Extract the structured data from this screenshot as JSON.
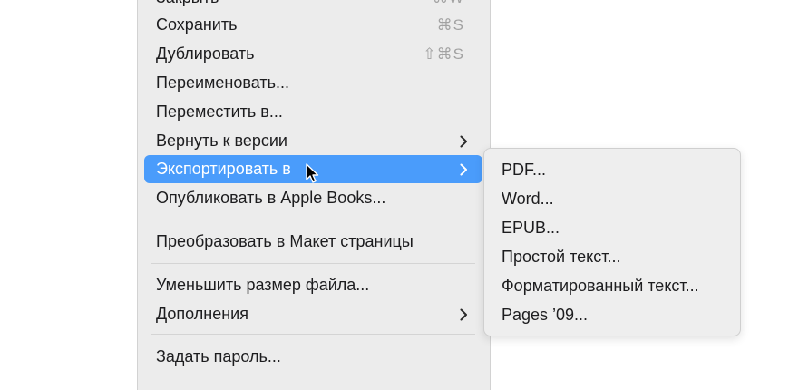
{
  "file_menu": {
    "items": [
      {
        "label": "Закрыть",
        "shortcut": "⌘W"
      },
      {
        "label": "Сохранить",
        "shortcut": "⌘S"
      },
      {
        "label": "Дублировать",
        "shortcut": "⇧⌘S"
      },
      {
        "label": "Переименовать..."
      },
      {
        "label": "Переместить в..."
      },
      {
        "label": "Вернуть к версии"
      },
      {
        "label": "Экспортировать в"
      },
      {
        "label": "Опубликовать в Apple Books..."
      },
      {
        "label": "Преобразовать в Макет страницы"
      },
      {
        "label": "Уменьшить размер файла..."
      },
      {
        "label": "Дополнения"
      },
      {
        "label": "Задать пароль..."
      }
    ],
    "highlighted_item": "Экспортировать в"
  },
  "export_submenu": {
    "items": [
      {
        "label": "PDF..."
      },
      {
        "label": "Word..."
      },
      {
        "label": "EPUB..."
      },
      {
        "label": "Простой текст..."
      },
      {
        "label": "Форматированный текст..."
      },
      {
        "label": "Pages ’09..."
      }
    ]
  },
  "colors": {
    "highlight": "#4a9cfb",
    "menu_background": "#ececec",
    "shortcut_text": "#a2a2a2"
  },
  "icons": {
    "submenu_indicator": "chevron-right-icon",
    "pointer": "mouse-cursor-icon"
  }
}
